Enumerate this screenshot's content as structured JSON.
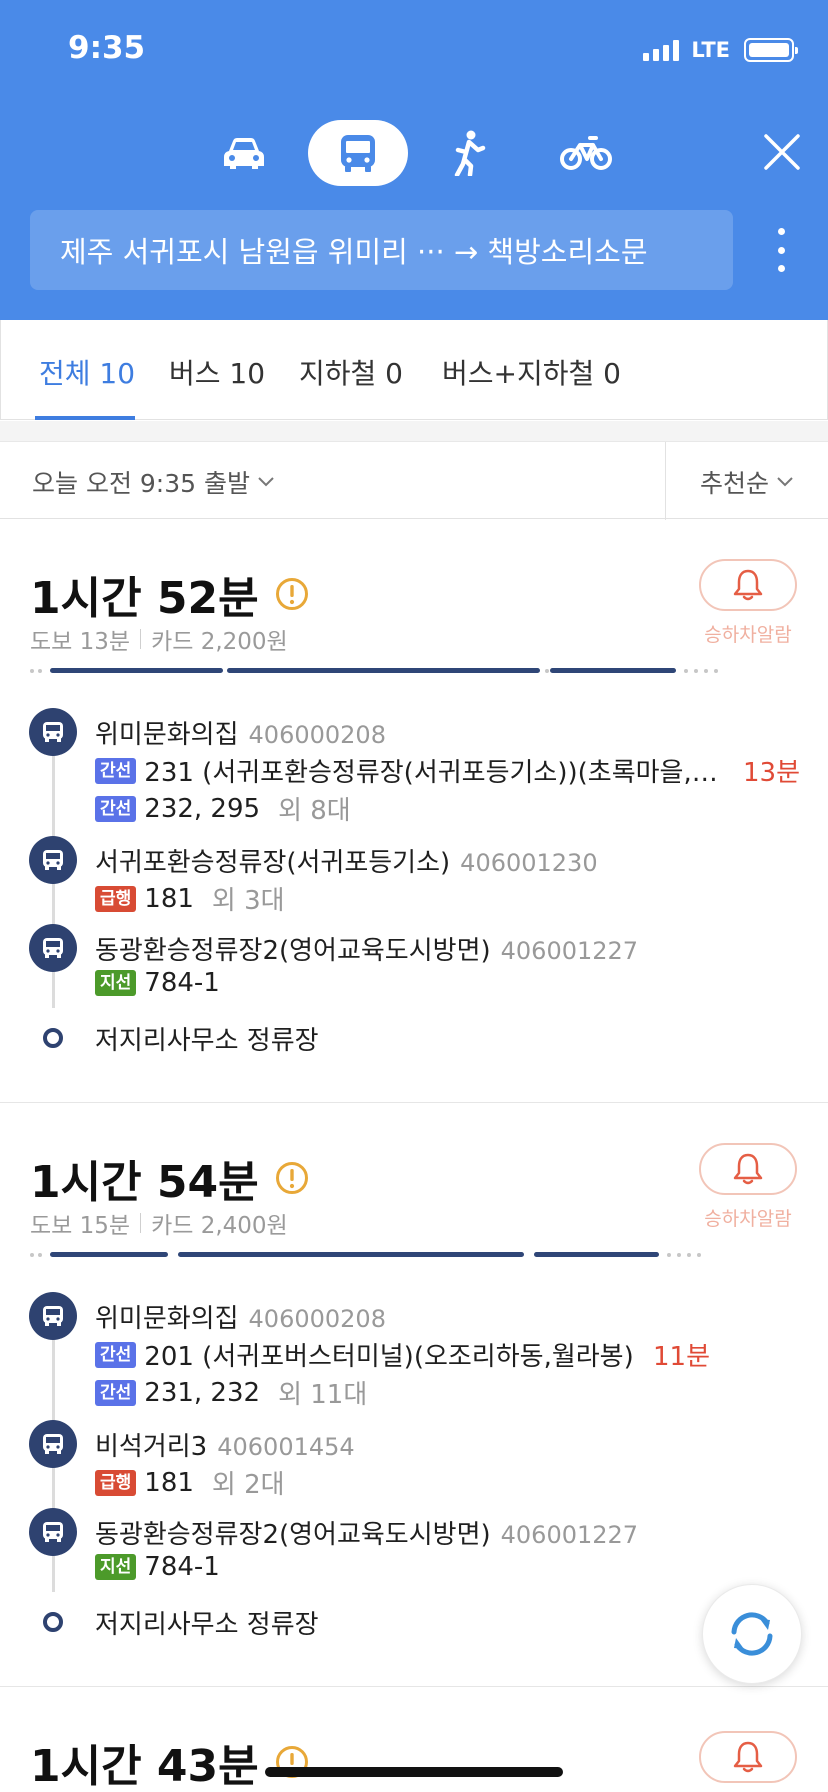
{
  "status_bar": {
    "time": "9:35",
    "network": "LTE"
  },
  "header": {
    "modes": [
      "car",
      "bus",
      "walk",
      "bicycle"
    ],
    "active_mode": "bus",
    "route_text": "제주 서귀포시 남원읍 위미리 ··· → 책방소리소문"
  },
  "tabs": [
    {
      "label": "전체 10"
    },
    {
      "label": "버스 10"
    },
    {
      "label": "지하철 0"
    },
    {
      "label": "버스+지하철 0"
    }
  ],
  "filter": {
    "departure": "오늘 오전 9:35 출발",
    "sort": "추천순"
  },
  "alarm_label": "승하차알람",
  "routes": [
    {
      "duration": "1시간 52분",
      "walk": "도보 13분",
      "fare": "카드 2,200원",
      "stops": [
        {
          "name": "위미문화의집",
          "id": "406000208",
          "lines": [
            {
              "badge": "간선",
              "text": "231 (서귀포환승정류장(서귀포등기소))(초록마을,…",
              "eta": "13분"
            },
            {
              "badge": "간선",
              "text": "232, 295",
              "others": "외 8대"
            }
          ]
        },
        {
          "name": "서귀포환승정류장(서귀포등기소)",
          "id": "406001230",
          "lines": [
            {
              "badge": "급행",
              "text": "181",
              "others": "외 3대"
            }
          ]
        },
        {
          "name": "동광환승정류장2(영어교육도시방면)",
          "id": "406001227",
          "lines": [
            {
              "badge": "지선",
              "text": "784-1"
            }
          ]
        }
      ],
      "destination": "저지리사무소 정류장"
    },
    {
      "duration": "1시간 54분",
      "walk": "도보 15분",
      "fare": "카드 2,400원",
      "stops": [
        {
          "name": "위미문화의집",
          "id": "406000208",
          "lines": [
            {
              "badge": "간선",
              "text": "201 (서귀포버스터미널)(오조리하동,월라봉)",
              "eta": "11분"
            },
            {
              "badge": "간선",
              "text": "231, 232",
              "others": "외 11대"
            }
          ]
        },
        {
          "name": "비석거리3",
          "id": "406001454",
          "lines": [
            {
              "badge": "급행",
              "text": "181",
              "others": "외 2대"
            }
          ]
        },
        {
          "name": "동광환승정류장2(영어교육도시방면)",
          "id": "406001227",
          "lines": [
            {
              "badge": "지선",
              "text": "784-1"
            }
          ]
        }
      ],
      "destination": "저지리사무소 정류장"
    },
    {
      "duration": "1시간 43분"
    }
  ],
  "colors": {
    "header_bg": "#4a8ae8",
    "active_tab": "#3e7de0",
    "bus_circle": "#2e4270",
    "badge_trunk": "#5a72e8",
    "badge_express": "#d84b34",
    "badge_branch": "#4c9a2a",
    "eta": "#e04a36",
    "warning": "#e8a838"
  },
  "icons": {
    "mode_car": "car-icon",
    "mode_bus": "bus-icon",
    "mode_walk": "walking-icon",
    "mode_bike": "bicycle-icon",
    "close": "close-icon",
    "more": "more-vertical-icon",
    "warning": "warning-icon",
    "alarm": "bell-icon",
    "refresh": "refresh-icon"
  }
}
